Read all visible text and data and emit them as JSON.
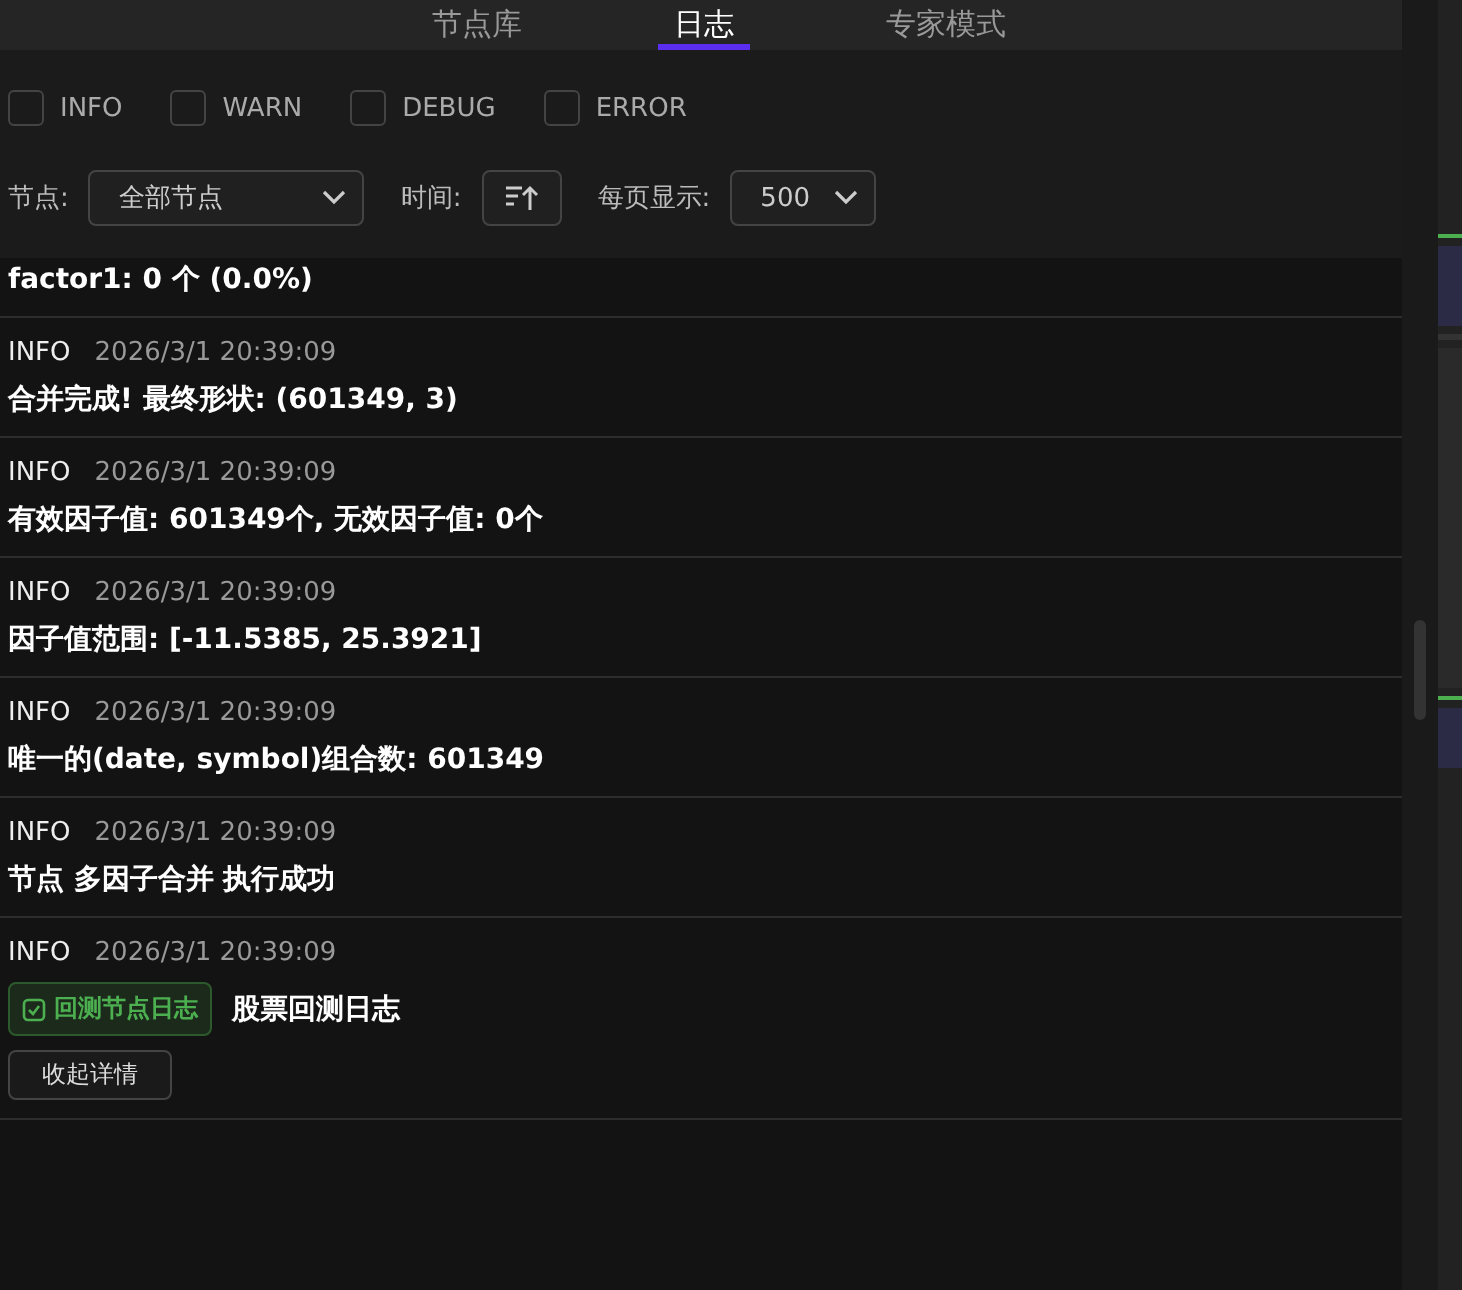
{
  "tabs": [
    {
      "label": "节点库",
      "selected": false
    },
    {
      "label": "日志",
      "selected": true
    },
    {
      "label": "专家模式",
      "selected": false
    }
  ],
  "levels": [
    {
      "label": "INFO",
      "checked": false
    },
    {
      "label": "WARN",
      "checked": false
    },
    {
      "label": "DEBUG",
      "checked": false
    },
    {
      "label": "ERROR",
      "checked": false
    }
  ],
  "filters": {
    "node_label": "节点:",
    "node_value": "全部节点",
    "time_label": "时间:",
    "page_size_label": "每页显示:",
    "page_size_value": "500"
  },
  "partial_message": "factor1: 0 个 (0.0%)",
  "logs": [
    {
      "level": "INFO",
      "time": "2026/3/1 20:39:09",
      "message": "合并完成! 最终形状: (601349, 3)"
    },
    {
      "level": "INFO",
      "time": "2026/3/1 20:39:09",
      "message": "有效因子值: 601349个, 无效因子值: 0个"
    },
    {
      "level": "INFO",
      "time": "2026/3/1 20:39:09",
      "message": "因子值范围: [-11.5385, 25.3921]"
    },
    {
      "level": "INFO",
      "time": "2026/3/1 20:39:09",
      "message": "唯一的(date, symbol)组合数: 601349"
    },
    {
      "level": "INFO",
      "time": "2026/3/1 20:39:09",
      "message": "节点 多因子合并 执行成功"
    },
    {
      "level": "INFO",
      "time": "2026/3/1 20:39:09",
      "tag": "回测节点日志",
      "message": "股票回测日志",
      "button": "收起详情"
    }
  ]
}
